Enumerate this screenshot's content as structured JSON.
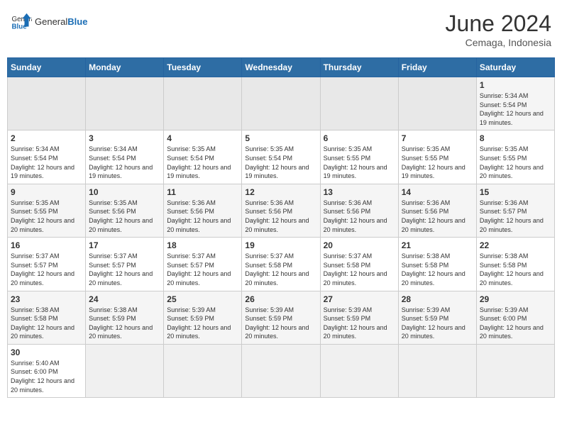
{
  "header": {
    "logo_general": "General",
    "logo_blue": "Blue",
    "title": "June 2024",
    "subtitle": "Cemaga, Indonesia"
  },
  "weekdays": [
    "Sunday",
    "Monday",
    "Tuesday",
    "Wednesday",
    "Thursday",
    "Friday",
    "Saturday"
  ],
  "weeks": [
    [
      {
        "day": "",
        "info": "",
        "empty": true
      },
      {
        "day": "",
        "info": "",
        "empty": true
      },
      {
        "day": "",
        "info": "",
        "empty": true
      },
      {
        "day": "",
        "info": "",
        "empty": true
      },
      {
        "day": "",
        "info": "",
        "empty": true
      },
      {
        "day": "",
        "info": "",
        "empty": true
      },
      {
        "day": "1",
        "info": "Sunrise: 5:34 AM\nSunset: 5:54 PM\nDaylight: 12 hours and 19 minutes."
      }
    ],
    [
      {
        "day": "2",
        "info": "Sunrise: 5:34 AM\nSunset: 5:54 PM\nDaylight: 12 hours and 19 minutes."
      },
      {
        "day": "3",
        "info": "Sunrise: 5:34 AM\nSunset: 5:54 PM\nDaylight: 12 hours and 19 minutes."
      },
      {
        "day": "4",
        "info": "Sunrise: 5:35 AM\nSunset: 5:54 PM\nDaylight: 12 hours and 19 minutes."
      },
      {
        "day": "5",
        "info": "Sunrise: 5:35 AM\nSunset: 5:54 PM\nDaylight: 12 hours and 19 minutes."
      },
      {
        "day": "6",
        "info": "Sunrise: 5:35 AM\nSunset: 5:55 PM\nDaylight: 12 hours and 19 minutes."
      },
      {
        "day": "7",
        "info": "Sunrise: 5:35 AM\nSunset: 5:55 PM\nDaylight: 12 hours and 19 minutes."
      },
      {
        "day": "8",
        "info": "Sunrise: 5:35 AM\nSunset: 5:55 PM\nDaylight: 12 hours and 20 minutes."
      }
    ],
    [
      {
        "day": "9",
        "info": "Sunrise: 5:35 AM\nSunset: 5:55 PM\nDaylight: 12 hours and 20 minutes."
      },
      {
        "day": "10",
        "info": "Sunrise: 5:35 AM\nSunset: 5:56 PM\nDaylight: 12 hours and 20 minutes."
      },
      {
        "day": "11",
        "info": "Sunrise: 5:36 AM\nSunset: 5:56 PM\nDaylight: 12 hours and 20 minutes."
      },
      {
        "day": "12",
        "info": "Sunrise: 5:36 AM\nSunset: 5:56 PM\nDaylight: 12 hours and 20 minutes."
      },
      {
        "day": "13",
        "info": "Sunrise: 5:36 AM\nSunset: 5:56 PM\nDaylight: 12 hours and 20 minutes."
      },
      {
        "day": "14",
        "info": "Sunrise: 5:36 AM\nSunset: 5:56 PM\nDaylight: 12 hours and 20 minutes."
      },
      {
        "day": "15",
        "info": "Sunrise: 5:36 AM\nSunset: 5:57 PM\nDaylight: 12 hours and 20 minutes."
      }
    ],
    [
      {
        "day": "16",
        "info": "Sunrise: 5:37 AM\nSunset: 5:57 PM\nDaylight: 12 hours and 20 minutes."
      },
      {
        "day": "17",
        "info": "Sunrise: 5:37 AM\nSunset: 5:57 PM\nDaylight: 12 hours and 20 minutes."
      },
      {
        "day": "18",
        "info": "Sunrise: 5:37 AM\nSunset: 5:57 PM\nDaylight: 12 hours and 20 minutes."
      },
      {
        "day": "19",
        "info": "Sunrise: 5:37 AM\nSunset: 5:58 PM\nDaylight: 12 hours and 20 minutes."
      },
      {
        "day": "20",
        "info": "Sunrise: 5:37 AM\nSunset: 5:58 PM\nDaylight: 12 hours and 20 minutes."
      },
      {
        "day": "21",
        "info": "Sunrise: 5:38 AM\nSunset: 5:58 PM\nDaylight: 12 hours and 20 minutes."
      },
      {
        "day": "22",
        "info": "Sunrise: 5:38 AM\nSunset: 5:58 PM\nDaylight: 12 hours and 20 minutes."
      }
    ],
    [
      {
        "day": "23",
        "info": "Sunrise: 5:38 AM\nSunset: 5:58 PM\nDaylight: 12 hours and 20 minutes."
      },
      {
        "day": "24",
        "info": "Sunrise: 5:38 AM\nSunset: 5:59 PM\nDaylight: 12 hours and 20 minutes."
      },
      {
        "day": "25",
        "info": "Sunrise: 5:39 AM\nSunset: 5:59 PM\nDaylight: 12 hours and 20 minutes."
      },
      {
        "day": "26",
        "info": "Sunrise: 5:39 AM\nSunset: 5:59 PM\nDaylight: 12 hours and 20 minutes."
      },
      {
        "day": "27",
        "info": "Sunrise: 5:39 AM\nSunset: 5:59 PM\nDaylight: 12 hours and 20 minutes."
      },
      {
        "day": "28",
        "info": "Sunrise: 5:39 AM\nSunset: 5:59 PM\nDaylight: 12 hours and 20 minutes."
      },
      {
        "day": "29",
        "info": "Sunrise: 5:39 AM\nSunset: 6:00 PM\nDaylight: 12 hours and 20 minutes."
      }
    ],
    [
      {
        "day": "30",
        "info": "Sunrise: 5:40 AM\nSunset: 6:00 PM\nDaylight: 12 hours and 20 minutes."
      },
      {
        "day": "",
        "info": "",
        "empty": true
      },
      {
        "day": "",
        "info": "",
        "empty": true
      },
      {
        "day": "",
        "info": "",
        "empty": true
      },
      {
        "day": "",
        "info": "",
        "empty": true
      },
      {
        "day": "",
        "info": "",
        "empty": true
      },
      {
        "day": "",
        "info": "",
        "empty": true
      }
    ]
  ]
}
